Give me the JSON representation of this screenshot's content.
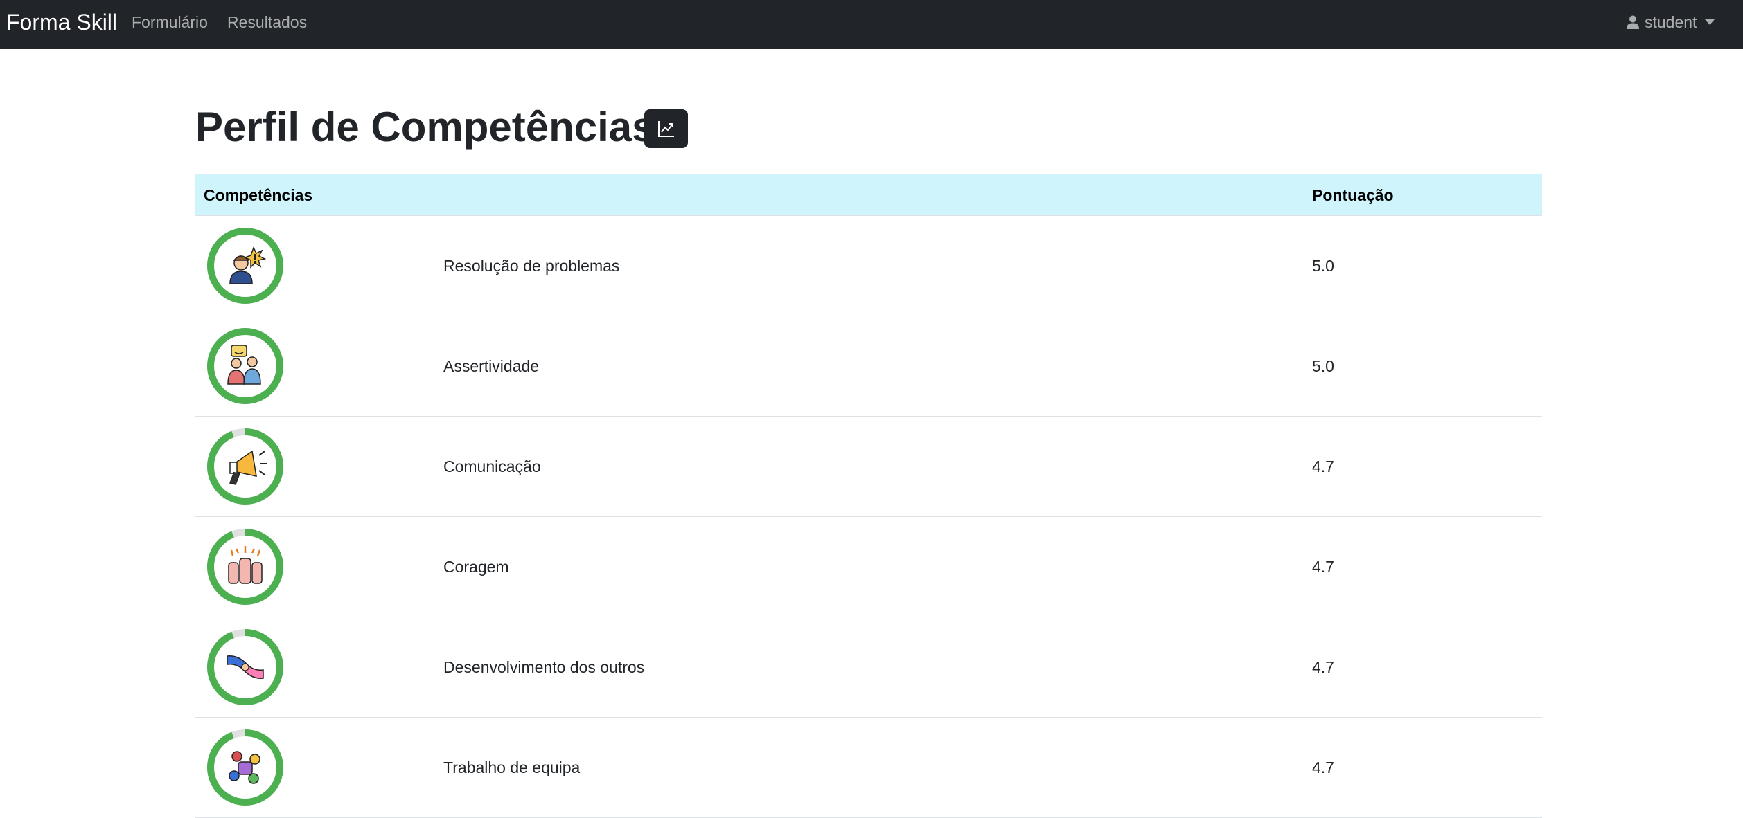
{
  "navbar": {
    "brand": "Forma Skill",
    "links": [
      "Formulário",
      "Resultados"
    ],
    "user": "student"
  },
  "page": {
    "title": "Perfil de Competências"
  },
  "table": {
    "headers": [
      "Competências",
      "Pontuação"
    ],
    "rows": [
      {
        "name": "Resolução de problemas",
        "score": "5.0",
        "icon": "problem-solving-icon",
        "fraction": 1.0
      },
      {
        "name": "Assertividade",
        "score": "5.0",
        "icon": "assertiveness-icon",
        "fraction": 1.0
      },
      {
        "name": "Comunicação",
        "score": "4.7",
        "icon": "megaphone-icon",
        "fraction": 0.94
      },
      {
        "name": "Coragem",
        "score": "4.7",
        "icon": "raised-fists-icon",
        "fraction": 0.94
      },
      {
        "name": "Desenvolvimento dos outros",
        "score": "4.7",
        "icon": "helping-hands-icon",
        "fraction": 0.94
      },
      {
        "name": "Trabalho de equipa",
        "score": "4.7",
        "icon": "teamwork-icon",
        "fraction": 0.94
      }
    ]
  },
  "colors": {
    "ring_fill": "#4caf50",
    "ring_track": "#e0e0e0",
    "navbar_bg": "#212529",
    "header_bg": "#cff4fc"
  }
}
